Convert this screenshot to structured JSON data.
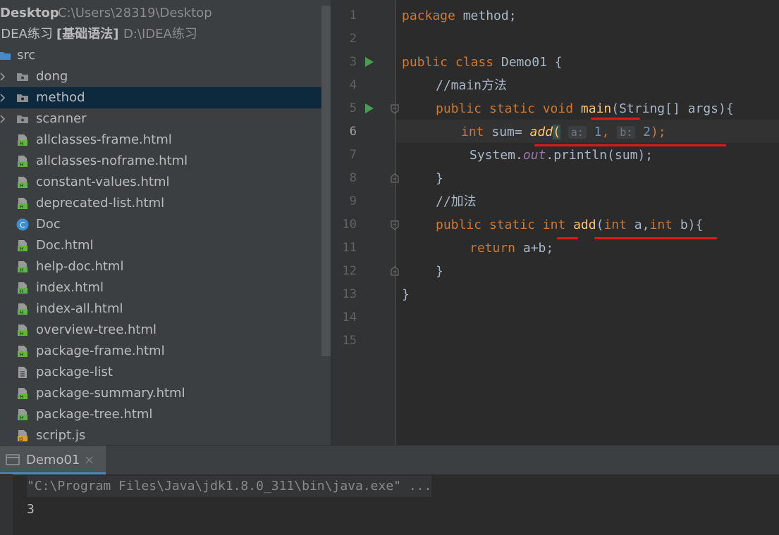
{
  "project_tree": {
    "rows": [
      {
        "name": "Desktop",
        "path": "C:\\Users\\28319\\Desktop"
      },
      {
        "name": "IDEA练习",
        "tag": "[基础语法]",
        "path": "D:\\IDEA练习"
      },
      {
        "name": "src"
      },
      {
        "name": "dong"
      },
      {
        "name": "method"
      },
      {
        "name": "scanner"
      },
      {
        "name": "allclasses-frame.html"
      },
      {
        "name": "allclasses-noframe.html"
      },
      {
        "name": "constant-values.html"
      },
      {
        "name": "deprecated-list.html"
      },
      {
        "name": "Doc"
      },
      {
        "name": "Doc.html"
      },
      {
        "name": "help-doc.html"
      },
      {
        "name": "index.html"
      },
      {
        "name": "index-all.html"
      },
      {
        "name": "overview-tree.html"
      },
      {
        "name": "package-frame.html"
      },
      {
        "name": "package-list"
      },
      {
        "name": "package-summary.html"
      },
      {
        "name": "package-tree.html"
      },
      {
        "name": "script.js"
      }
    ]
  },
  "editor": {
    "line_numbers": [
      "1",
      "2",
      "3",
      "4",
      "5",
      "6",
      "7",
      "8",
      "9",
      "10",
      "11",
      "12",
      "13",
      "14",
      "15"
    ],
    "current_line": "6",
    "tokens": {
      "l1_kw": "package",
      "l1_rest": " method;",
      "l3_kw": "public class",
      "l3_rest": " Demo01 {",
      "l4": "//main方法",
      "l5_kw1": "public static void",
      "l5_fn": "main",
      "l5_rest": "(String[] args){",
      "l6_kw": "int",
      "l6_a": " sum= ",
      "l6_fn": "add",
      "l6_paren": "(",
      "l6_hint_a": "a:",
      "l6_v1": "1",
      "l6_comma": ", ",
      "l6_hint_b": "b:",
      "l6_v2": "2",
      "l6_end": ");",
      "l7_a": "System.",
      "l7_out": "out",
      "l7_b": ".println(sum);",
      "l8": "}",
      "l9": "//加法",
      "l10_kw1": "public static",
      "l10_kw2": "int",
      "l10_fn": "add",
      "l10_p1": "(",
      "l10_kw3": "int",
      "l10_p2": " a,",
      "l10_kw4": "int",
      "l10_p3": " b){",
      "l11_kw": "return",
      "l11_rest": " a+b;",
      "l12": "}",
      "l13": "}"
    }
  },
  "run_panel": {
    "tab_label": "Demo01",
    "command": "\"C:\\Program Files\\Java\\jdk1.8.0_311\\bin\\java.exe\" ...",
    "output": "3"
  },
  "colors": {
    "sidebar_bg": "#3c3f41",
    "editor_bg": "#2b2b2b",
    "keyword": "#cc7832",
    "function": "#ffc66d",
    "number": "#6897bb",
    "annotation_red": "#e01a1a"
  },
  "icons": [
    "folder-icon",
    "package-icon",
    "html-file-icon",
    "class-icon",
    "text-file-icon",
    "js-file-icon",
    "run-icon",
    "fold-icon",
    "close-icon",
    "console-icon"
  ]
}
